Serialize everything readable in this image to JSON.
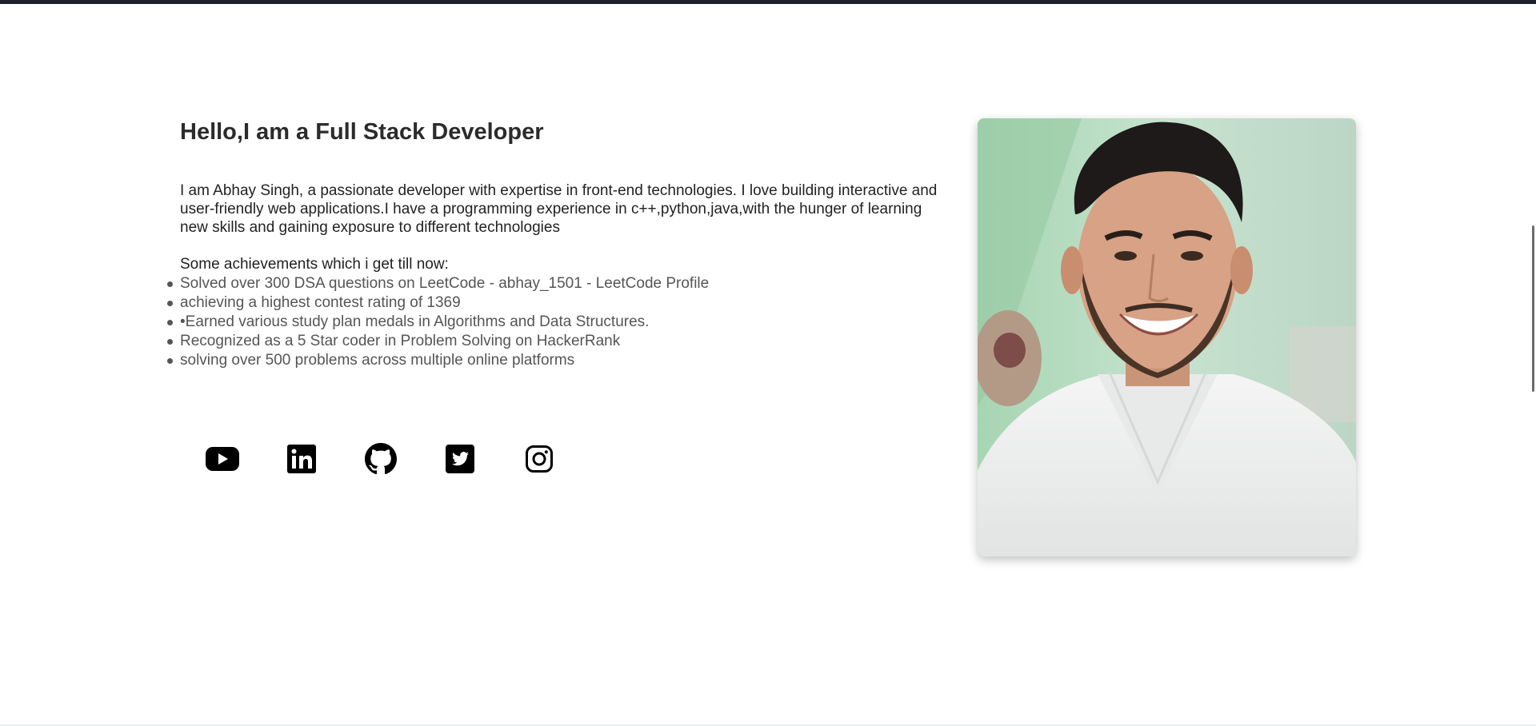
{
  "about": {
    "title": "Hello,I am a Full Stack Developer",
    "bio": "I am Abhay Singh, a passionate developer with expertise in front-end technologies. I love building interactive and user-friendly web applications.I have a programming experience in c++,python,java,with the hunger of learning new skills and gaining exposure to different technologies",
    "achievements_heading": "Some achievements which i get till now:",
    "achievements": [
      "Solved over 300 DSA questions on LeetCode - abhay_1501 - LeetCode Profile",
      "achieving a highest contest rating of 1369",
      "•Earned various study plan medals in Algorithms and Data Structures.",
      "Recognized as a 5 Star coder in Problem Solving on HackerRank",
      "solving over 500 problems across multiple online platforms"
    ]
  },
  "socials": [
    {
      "icon": "youtube-icon"
    },
    {
      "icon": "linkedin-icon"
    },
    {
      "icon": "github-icon"
    },
    {
      "icon": "twitter-icon"
    },
    {
      "icon": "instagram-icon"
    }
  ],
  "colors": {
    "top_strip": "#1f1f2a",
    "title": "#2b2b2b",
    "list_text": "#555555",
    "icon": "#000000",
    "photo_wall": "#b9dcc4"
  }
}
